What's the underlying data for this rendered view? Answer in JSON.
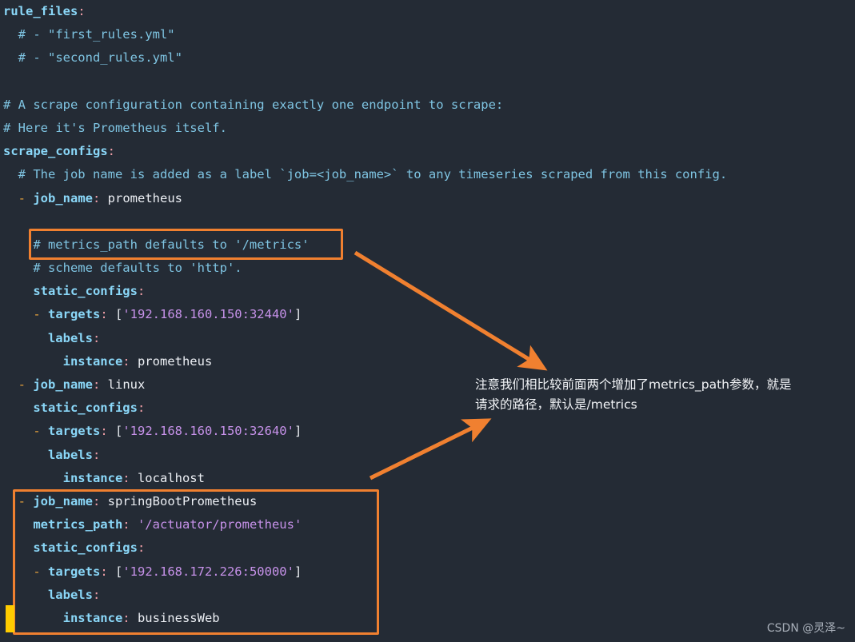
{
  "editor": {
    "background_color": "#242b35",
    "colors": {
      "key": "#8ad7f8",
      "colon": "#f2a0a8",
      "dash": "#e8a33d",
      "comment": "#7fc5e3",
      "value": "#eceff4",
      "string": "#c792ea",
      "highlight_border": "#f08030",
      "gutter_marker": "#ffcc00"
    },
    "lines": [
      {
        "indent": 0,
        "tokens": [
          {
            "t": "k",
            "v": "rule_files"
          },
          {
            "t": "colon",
            "v": ":"
          }
        ]
      },
      {
        "indent": 2,
        "tokens": [
          {
            "t": "cmt",
            "v": "# - \"first_rules.yml\""
          }
        ]
      },
      {
        "indent": 2,
        "tokens": [
          {
            "t": "cmt",
            "v": "# - \"second_rules.yml\""
          }
        ]
      },
      {
        "indent": 0,
        "tokens": []
      },
      {
        "indent": 0,
        "tokens": [
          {
            "t": "cmt",
            "v": "# A scrape configuration containing exactly one endpoint to scrape:"
          }
        ]
      },
      {
        "indent": 0,
        "tokens": [
          {
            "t": "cmt",
            "v": "# Here it's Prometheus itself."
          }
        ]
      },
      {
        "indent": 0,
        "tokens": [
          {
            "t": "k",
            "v": "scrape_configs"
          },
          {
            "t": "colon",
            "v": ":"
          }
        ]
      },
      {
        "indent": 2,
        "tokens": [
          {
            "t": "cmt",
            "v": "# The job name is added as a label `job=<job_name>` to any timeseries scraped from this config."
          }
        ]
      },
      {
        "indent": 2,
        "tokens": [
          {
            "t": "dash",
            "v": "- "
          },
          {
            "t": "k",
            "v": "job_name"
          },
          {
            "t": "colon",
            "v": ":"
          },
          {
            "t": "val",
            "v": " prometheus"
          }
        ]
      },
      {
        "indent": 0,
        "tokens": []
      },
      {
        "indent": 4,
        "tokens": [
          {
            "t": "cmt",
            "v": "# metrics_path defaults to '/metrics'"
          }
        ]
      },
      {
        "indent": 4,
        "tokens": [
          {
            "t": "cmt",
            "v": "# scheme defaults to 'http'."
          }
        ]
      },
      {
        "indent": 4,
        "tokens": [
          {
            "t": "k",
            "v": "static_configs"
          },
          {
            "t": "colon",
            "v": ":"
          }
        ]
      },
      {
        "indent": 4,
        "tokens": [
          {
            "t": "dash",
            "v": "- "
          },
          {
            "t": "k",
            "v": "targets"
          },
          {
            "t": "colon",
            "v": ":"
          },
          {
            "t": "brk",
            "v": " ["
          },
          {
            "t": "str",
            "v": "'192.168.160.150:32440'"
          },
          {
            "t": "brk",
            "v": "]"
          }
        ]
      },
      {
        "indent": 6,
        "tokens": [
          {
            "t": "k",
            "v": "labels"
          },
          {
            "t": "colon",
            "v": ":"
          }
        ]
      },
      {
        "indent": 8,
        "tokens": [
          {
            "t": "k",
            "v": "instance"
          },
          {
            "t": "colon",
            "v": ":"
          },
          {
            "t": "val",
            "v": " prometheus"
          }
        ]
      },
      {
        "indent": 2,
        "tokens": [
          {
            "t": "dash",
            "v": "- "
          },
          {
            "t": "k",
            "v": "job_name"
          },
          {
            "t": "colon",
            "v": ":"
          },
          {
            "t": "val",
            "v": " linux"
          }
        ]
      },
      {
        "indent": 4,
        "tokens": [
          {
            "t": "k",
            "v": "static_configs"
          },
          {
            "t": "colon",
            "v": ":"
          }
        ]
      },
      {
        "indent": 4,
        "tokens": [
          {
            "t": "dash",
            "v": "- "
          },
          {
            "t": "k",
            "v": "targets"
          },
          {
            "t": "colon",
            "v": ":"
          },
          {
            "t": "brk",
            "v": " ["
          },
          {
            "t": "str",
            "v": "'192.168.160.150:32640'"
          },
          {
            "t": "brk",
            "v": "]"
          }
        ]
      },
      {
        "indent": 6,
        "tokens": [
          {
            "t": "k",
            "v": "labels"
          },
          {
            "t": "colon",
            "v": ":"
          }
        ]
      },
      {
        "indent": 8,
        "tokens": [
          {
            "t": "k",
            "v": "instance"
          },
          {
            "t": "colon",
            "v": ":"
          },
          {
            "t": "val",
            "v": " localhost"
          }
        ]
      },
      {
        "indent": 2,
        "tokens": [
          {
            "t": "dash",
            "v": "- "
          },
          {
            "t": "k",
            "v": "job_name"
          },
          {
            "t": "colon",
            "v": ":"
          },
          {
            "t": "val",
            "v": " springBootPrometheus"
          }
        ]
      },
      {
        "indent": 4,
        "tokens": [
          {
            "t": "k",
            "v": "metrics_path"
          },
          {
            "t": "colon",
            "v": ":"
          },
          {
            "t": "str",
            "v": " '/actuator/prometheus'"
          }
        ]
      },
      {
        "indent": 4,
        "tokens": [
          {
            "t": "k",
            "v": "static_configs"
          },
          {
            "t": "colon",
            "v": ":"
          }
        ]
      },
      {
        "indent": 4,
        "tokens": [
          {
            "t": "dash",
            "v": "- "
          },
          {
            "t": "k",
            "v": "targets"
          },
          {
            "t": "colon",
            "v": ":"
          },
          {
            "t": "brk",
            "v": " ["
          },
          {
            "t": "str",
            "v": "'192.168.172.226:50000'"
          },
          {
            "t": "brk",
            "v": "]"
          }
        ]
      },
      {
        "indent": 6,
        "tokens": [
          {
            "t": "k",
            "v": "labels"
          },
          {
            "t": "colon",
            "v": ":"
          }
        ]
      },
      {
        "indent": 8,
        "tokens": [
          {
            "t": "k",
            "v": "instance"
          },
          {
            "t": "colon",
            "v": ":"
          },
          {
            "t": "val",
            "v": " businessWeb"
          }
        ]
      }
    ]
  },
  "annotations": {
    "note_text": "注意我们相比较前面两个增加了metrics_path参数，就是请求的路径，默认是/metrics",
    "highlight_boxes": [
      {
        "name": "metrics-path-comment-highlight"
      },
      {
        "name": "springboot-job-highlight"
      }
    ],
    "arrows": [
      {
        "name": "arrow-from-metrics-comment-to-note"
      },
      {
        "name": "arrow-from-springboot-box-to-note"
      }
    ]
  },
  "watermark": {
    "text": "CSDN @灵泽~"
  }
}
